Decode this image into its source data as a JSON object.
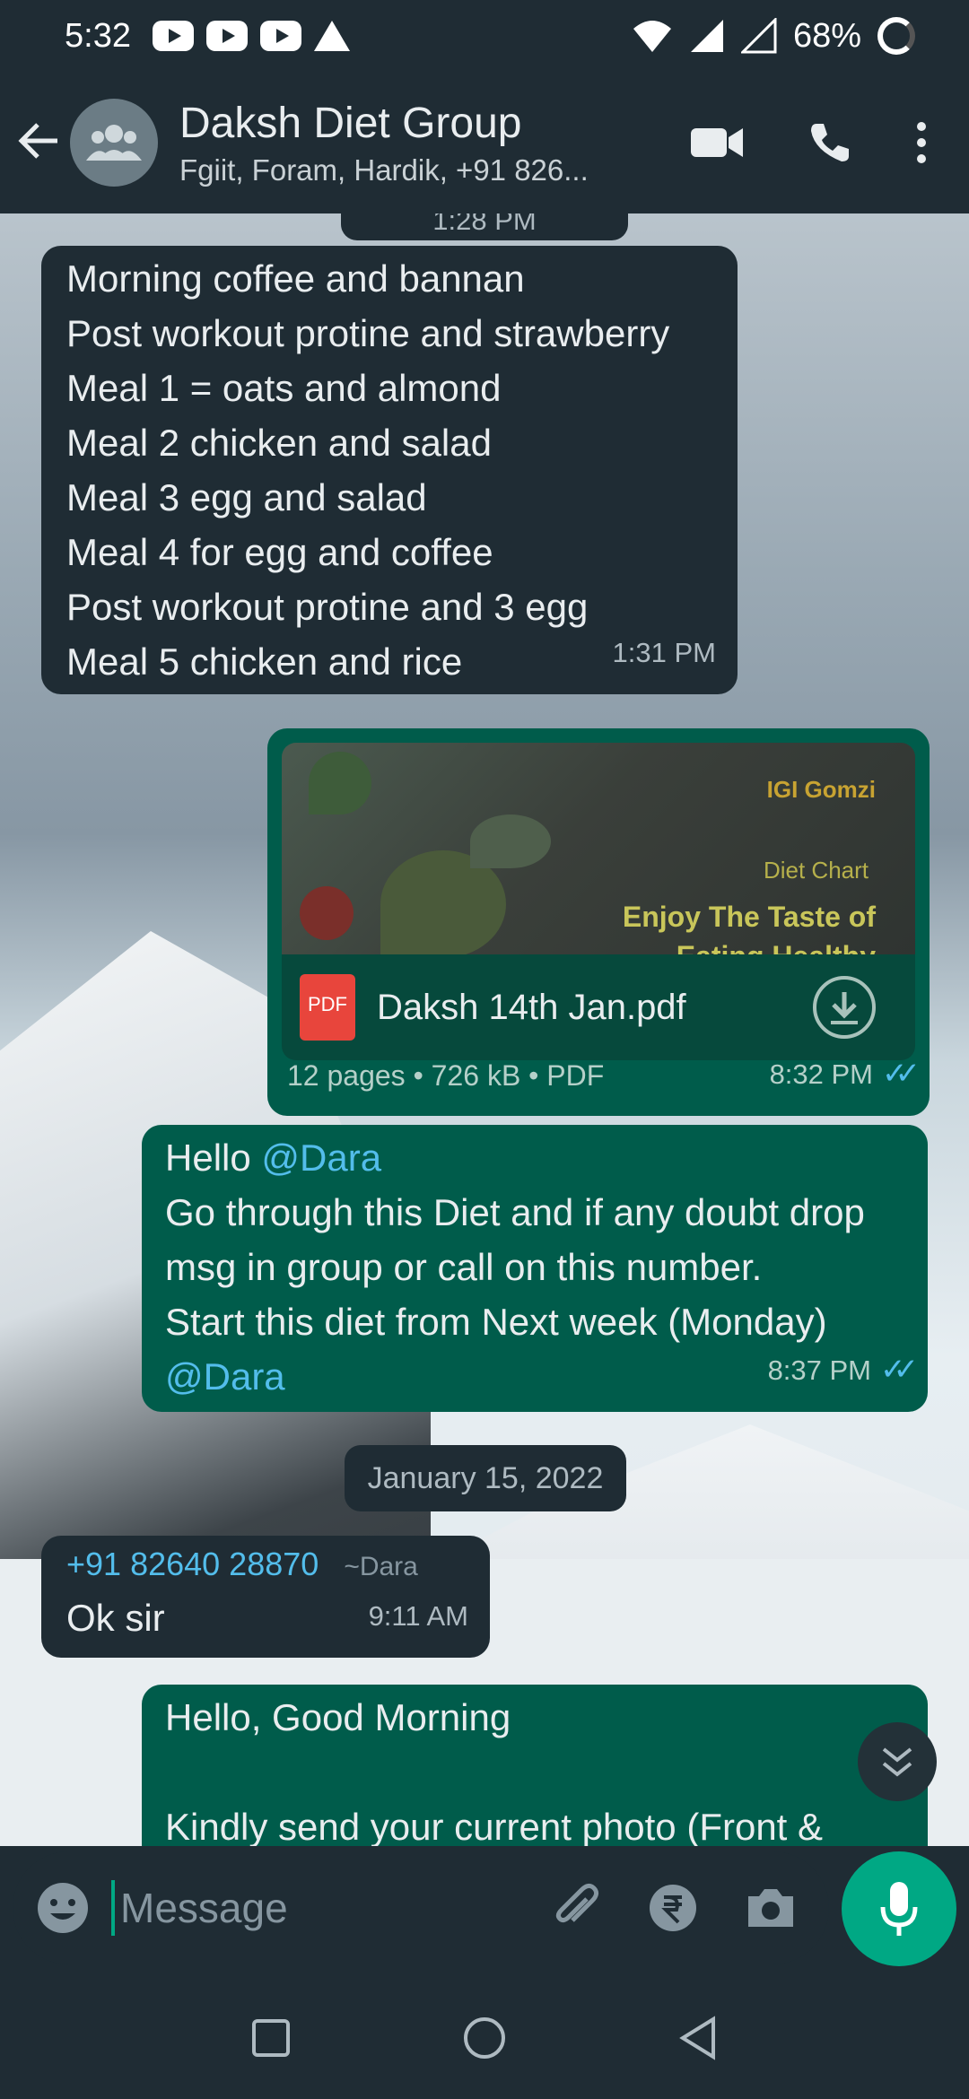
{
  "status_bar": {
    "time": "5:32",
    "battery": "68%",
    "icons": [
      "youtube-icon",
      "youtube-icon",
      "youtube-icon",
      "warning-icon",
      "wifi-icon",
      "signal-icon",
      "signal-icon",
      "battery-icon"
    ]
  },
  "header": {
    "title": "Daksh Diet Group",
    "subtitle": "Fgiit, Foram, Hardik, +91 826..."
  },
  "chat": {
    "top_time_chip": "1:28 PM",
    "messages": [
      {
        "type": "incoming",
        "lines": [
          "Morning coffee and bannan",
          "Post workout protine and strawberry",
          "Meal 1 = oats and almond",
          "Meal 2 chicken and salad",
          "Meal 3 egg and salad",
          "Meal 4 for egg and coffee",
          "Post workout protine and 3 egg",
          "Meal 5 chicken and rice"
        ],
        "time": "1:31 PM"
      },
      {
        "type": "outgoing-document",
        "preview_brand": "IGI Gomzi",
        "preview_title": "Diet Chart",
        "preview_line1": "Enjoy The Taste of",
        "preview_line2": "Eating Healthy",
        "file_icon_label": "PDF",
        "file_name": "Daksh 14th Jan.pdf",
        "meta": "12 pages • 726 kB • PDF",
        "time": "8:32 PM",
        "ticks": "✓✓"
      },
      {
        "type": "outgoing",
        "greeting": "Hello ",
        "mention1": "@Dara",
        "line2": "Go through this Diet and if any doubt drop",
        "line3": "msg in group or call on this number.",
        "line4": "Start this diet from Next week (Monday)",
        "mention2": "@Dara",
        "time": "8:37 PM",
        "ticks": "✓✓"
      },
      {
        "type": "date",
        "label": "January 15, 2022"
      },
      {
        "type": "incoming",
        "sender": "+91 82640 28870",
        "sender_name": "~Dara",
        "text": "Ok sir",
        "time": "9:11 AM"
      },
      {
        "type": "outgoing",
        "line1": "Hello, Good Morning",
        "line2": "Kindly send your current photo (Front &"
      }
    ]
  },
  "input": {
    "placeholder": "Message"
  },
  "colors": {
    "header_bg": "#1f2c34",
    "outgoing_bubble": "#005c4b",
    "incoming_bubble": "#1f2c34",
    "accent": "#00a884",
    "mention": "#53bdeb"
  }
}
